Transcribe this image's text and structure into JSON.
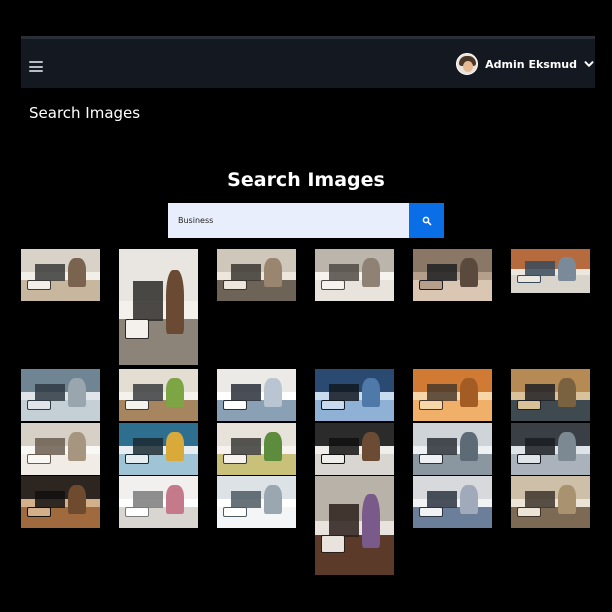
{
  "header": {
    "user_name": "Admin Eksmud"
  },
  "page_title": "Search Images",
  "search": {
    "title": "Search Images",
    "value": "Business"
  },
  "icons": {
    "menu": "hamburger-icon",
    "user_dropdown": "chevron-down-icon",
    "search": "search-icon"
  },
  "accent_color": "#0a6ee6",
  "results": [
    {
      "name": "laptop-and-notebook-on-desk",
      "colors": [
        "#d8d2c8",
        "#c7b79e",
        "#3a3a3a",
        "#7a6450",
        "#f2efe9"
      ]
    },
    {
      "name": "woman-working-on-laptop",
      "colors": [
        "#e9e6e1",
        "#8c8478",
        "#2d2a28",
        "#6b4a33",
        "#f4f1ec"
      ]
    },
    {
      "name": "team-meeting-around-table",
      "colors": [
        "#cfc7b9",
        "#6d6457",
        "#3b3631",
        "#9a8670",
        "#ece6dc"
      ]
    },
    {
      "name": "hand-writing-on-paper",
      "colors": [
        "#bcb5ab",
        "#e8e3dc",
        "#504a44",
        "#8f8275",
        "#f6f3ef"
      ]
    },
    {
      "name": "businessman-in-suit-hallway",
      "colors": [
        "#8b7766",
        "#d9c7b4",
        "#1e1e22",
        "#5a4a3e",
        "#b59f8a"
      ]
    },
    {
      "name": "open-plan-office",
      "colors": [
        "#b56b3e",
        "#d9d4cc",
        "#384a5c",
        "#7a8a98",
        "#ece7df"
      ]
    },
    {
      "name": "modern-office-building-exterior",
      "colors": [
        "#6f8594",
        "#c4cfd6",
        "#2f3a42",
        "#9aa6ae",
        "#dfe5e9"
      ]
    },
    {
      "name": "wooden-desk-with-plant",
      "colors": [
        "#e3ddd2",
        "#a7865f",
        "#3a3d3f",
        "#7da544",
        "#f5f2ed"
      ]
    },
    {
      "name": "celebrating-on-rooftop",
      "colors": [
        "#eceae6",
        "#8aa0b4",
        "#2a2f38",
        "#b9c6d2",
        "#ffffff"
      ]
    },
    {
      "name": "chess-pieces-close-up",
      "colors": [
        "#2b4a72",
        "#8fb1d6",
        "#101820",
        "#4f79a8",
        "#c9dbee"
      ]
    },
    {
      "name": "cafe-meeting-orange-room",
      "colors": [
        "#d07a34",
        "#f0b06a",
        "#4a3a2c",
        "#a35c24",
        "#f7d7a8"
      ]
    },
    {
      "name": "man-typing-on-laptop",
      "colors": [
        "#b58a55",
        "#3e4a50",
        "#1e2024",
        "#7a6240",
        "#d9c29a"
      ]
    },
    {
      "name": "empty-conference-room",
      "colors": [
        "#d6d0c6",
        "#f1ede6",
        "#6b5e50",
        "#a69680",
        "#faf8f4"
      ]
    },
    {
      "name": "flatlay-team-workspace",
      "colors": [
        "#2e6f8f",
        "#9fc4d6",
        "#1a2a33",
        "#d9a93a",
        "#e6eef2"
      ]
    },
    {
      "name": "monitor-on-desk-with-plants",
      "colors": [
        "#e7e2da",
        "#c9c07a",
        "#3a3a36",
        "#5c8c3c",
        "#f6f3ee"
      ]
    },
    {
      "name": "phone-and-chair-top-view",
      "colors": [
        "#2b2b2b",
        "#d9d6d1",
        "#111111",
        "#6b4b33",
        "#f0eeea"
      ]
    },
    {
      "name": "hands-typing-laptop-closeup",
      "colors": [
        "#cfd4d8",
        "#8b97a0",
        "#2a3036",
        "#5d6b76",
        "#eef1f3"
      ]
    },
    {
      "name": "laptop-on-wooden-table",
      "colors": [
        "#3a3f46",
        "#aab3bb",
        "#1a1d21",
        "#7c8892",
        "#dfe4e8"
      ]
    },
    {
      "name": "laptop-on-wood-desk-dark",
      "colors": [
        "#2c2520",
        "#a06a3e",
        "#121010",
        "#6e4a2e",
        "#d4b08a"
      ]
    },
    {
      "name": "white-desk-flatlay",
      "colors": [
        "#f1f0ee",
        "#d9d6d2",
        "#7b7b7b",
        "#c47a8a",
        "#ffffff"
      ]
    },
    {
      "name": "window-office-workstations",
      "colors": [
        "#dde2e6",
        "#f3f5f6",
        "#4e5a62",
        "#9aa7b0",
        "#ffffff"
      ]
    },
    {
      "name": "women-smiling-at-laptop",
      "colors": [
        "#b8b2a9",
        "#5b3a2a",
        "#2a1f1a",
        "#7a5a8a",
        "#e8e3dc"
      ]
    },
    {
      "name": "handshake-over-documents",
      "colors": [
        "#d7d9dc",
        "#6b7f9a",
        "#2c3440",
        "#a0aabb",
        "#f1f2f4"
      ]
    },
    {
      "name": "team-in-library-meeting",
      "colors": [
        "#cdbfa8",
        "#7d6a55",
        "#3d342c",
        "#a8926f",
        "#ece4d6"
      ]
    }
  ]
}
